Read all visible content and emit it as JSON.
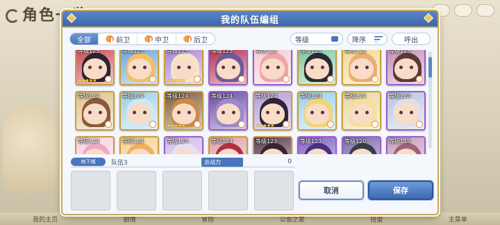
{
  "background": {
    "title": "角色一览",
    "bottom_nav": [
      "我的主页",
      "剧情",
      "冒险",
      "公会之家",
      "扭蛋",
      "主菜单"
    ]
  },
  "modal": {
    "title": "我的队伍编组"
  },
  "filters": {
    "tabs": [
      {
        "label": "全部",
        "active": true
      },
      {
        "label": "前卫",
        "active": false
      },
      {
        "label": "中卫",
        "active": false
      },
      {
        "label": "后卫",
        "active": false
      }
    ],
    "sort_label": "等级",
    "order_label": "降序",
    "call_label": "呼出"
  },
  "characters": [
    {
      "level": "等级125",
      "frame": "gold",
      "stars": "★★★★★",
      "hair": "#2b2430",
      "bg": "#c9464f"
    },
    {
      "level": "等级125",
      "frame": "gold",
      "stars": "",
      "hair": "#f0c064",
      "bg": "#6aa1d8"
    },
    {
      "level": "等级125",
      "frame": "gold",
      "stars": "★★★★★",
      "hair": "#f4e6c8",
      "bg": "#a77dd4"
    },
    {
      "level": "等级125",
      "frame": "purple",
      "stars": "",
      "hair": "#6e5a9a",
      "bg": "#b0294b"
    },
    {
      "level": "等级125",
      "frame": "purple",
      "stars": "",
      "hair": "#f2a3a8",
      "bg": "#f4c9d2"
    },
    {
      "level": "等级125",
      "frame": "gold",
      "stars": "",
      "hair": "#2a2a34",
      "bg": "#7cc49a"
    },
    {
      "level": "等级125",
      "frame": "gold",
      "stars": "",
      "hair": "#e8b072",
      "bg": "#f3d68d"
    },
    {
      "level": "等级125",
      "frame": "purple",
      "stars": "",
      "hair": "#5b3a3a",
      "bg": "#c48ab0"
    },
    {
      "level": "等级124",
      "frame": "gold",
      "stars": "",
      "hair": "#8a5a3a",
      "bg": "#e0c08a"
    },
    {
      "level": "等级124",
      "frame": "gold",
      "stars": "",
      "hair": "#cfe8f2",
      "bg": "#9ad0e8"
    },
    {
      "level": "等级124",
      "frame": "gold",
      "stars": "★★★★★",
      "hair": "#c98a4a",
      "bg": "#7a5a3a"
    },
    {
      "level": "等级124",
      "frame": "purple",
      "stars": "",
      "hair": "#9a8ac8",
      "bg": "#6b4aa0"
    },
    {
      "level": "等级124",
      "frame": "gold",
      "stars": "★★★★★",
      "hair": "#2f2438",
      "bg": "#b49ad8"
    },
    {
      "level": "等级124",
      "frame": "gold",
      "stars": "",
      "hair": "#f2d478",
      "bg": "#9ad0f0"
    },
    {
      "level": "等级124",
      "frame": "gold",
      "stars": "",
      "hair": "#f6e098",
      "bg": "#e8d4a0"
    },
    {
      "level": "等级124",
      "frame": "purple",
      "stars": "",
      "hair": "#e0e0ea",
      "bg": "#b8c4dc"
    },
    {
      "level": "等级124",
      "frame": "gold",
      "stars": "",
      "hair": "#f0a8c0",
      "bg": "#f6d0de"
    },
    {
      "level": "等级124",
      "frame": "gold",
      "stars": "",
      "hair": "#f0b060",
      "bg": "#f4d090"
    },
    {
      "level": "等级124",
      "frame": "purple",
      "stars": "",
      "hair": "#e8e0f0",
      "bg": "#d0b8e8"
    },
    {
      "level": "等级124",
      "frame": "gold",
      "stars": "",
      "hair": "#b03040",
      "bg": "#e0a0a8"
    },
    {
      "level": "等级123",
      "frame": "gold",
      "stars": "",
      "hair": "#3a2430",
      "bg": "#5a3a4a"
    },
    {
      "level": "等级123",
      "frame": "purple",
      "stars": "",
      "hair": "#4a3080",
      "bg": "#8060c0"
    },
    {
      "level": "等级120",
      "frame": "purple",
      "stars": "",
      "hair": "#3a3a4a",
      "bg": "#7a6aa8"
    },
    {
      "level": "等级118",
      "frame": "purple",
      "stars": "",
      "hair": "#a06080",
      "bg": "#c89ab8"
    }
  ],
  "team": {
    "tag": "地下城",
    "name": "队伍3",
    "power_label": "总战力",
    "power_value": "0",
    "slot_count": 5
  },
  "actions": {
    "cancel": "取消",
    "save": "保存"
  }
}
